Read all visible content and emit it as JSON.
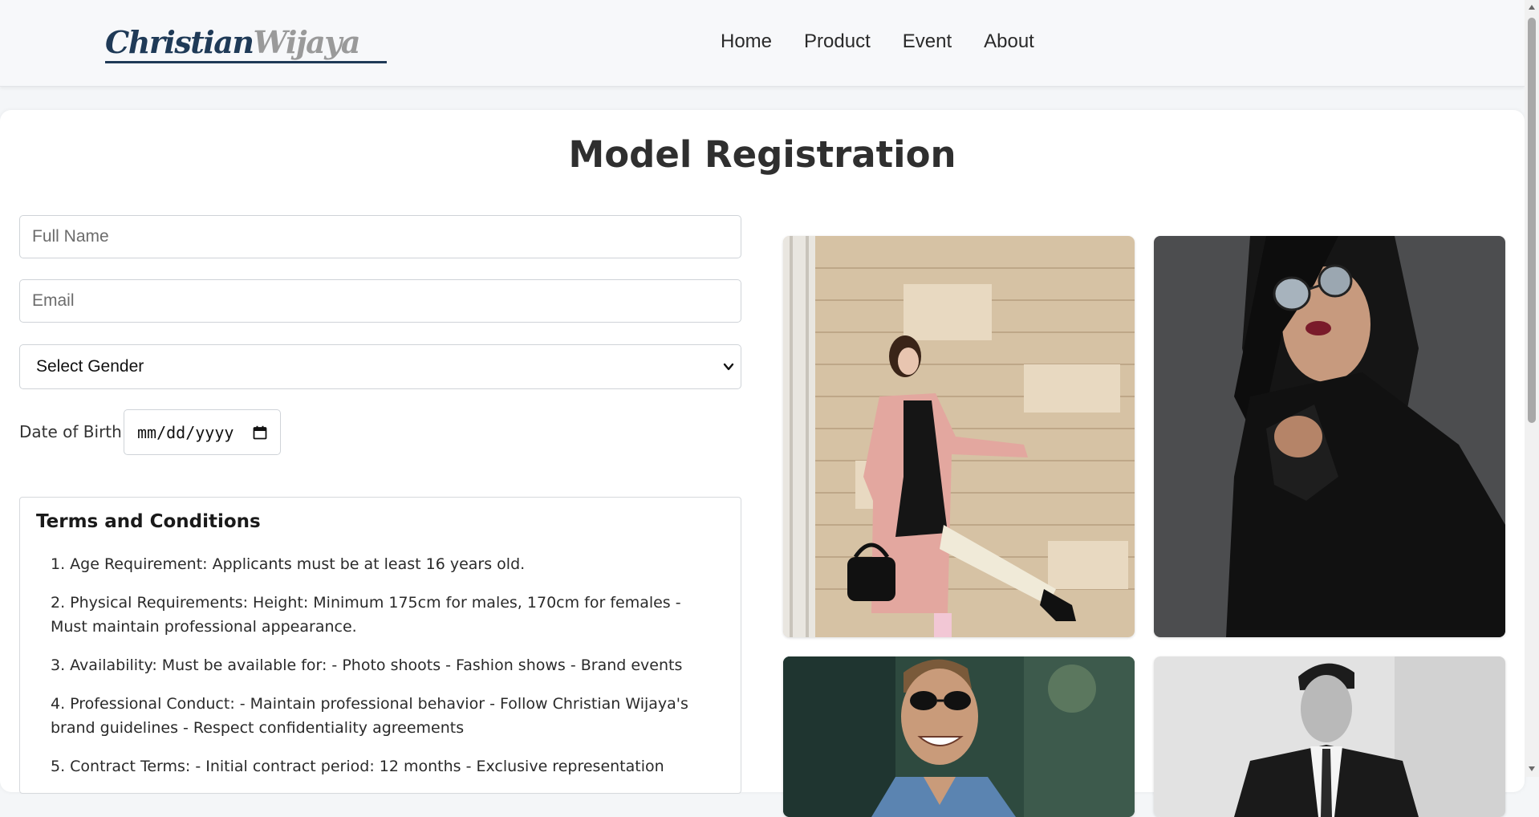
{
  "brand": {
    "first": "Christian",
    "last": "Wijaya"
  },
  "nav": [
    "Home",
    "Product",
    "Event",
    "About"
  ],
  "page_title": "Model Registration",
  "form": {
    "full_name_placeholder": "Full Name",
    "email_placeholder": "Email",
    "gender_selected": "Select Gender",
    "dob_label": "Date of Birth",
    "dob_placeholder": "mm/dd/yyyy"
  },
  "terms": {
    "title": "Terms and Conditions",
    "items": [
      "1. Age Requirement: Applicants must be at least 16 years old.",
      "2. Physical Requirements: Height: Minimum 175cm for males, 170cm for females - Must maintain professional appearance.",
      "3. Availability: Must be available for: - Photo shoots - Fashion shows - Brand events",
      "4. Professional Conduct: - Maintain professional behavior - Follow Christian Wijaya's brand guidelines - Respect confidentiality agreements",
      "5. Contract Terms: - Initial contract period: 12 months - Exclusive representation"
    ]
  },
  "colors": {
    "brand_dark": "#1f3a57",
    "brand_gray": "#9a9a9a",
    "page_bg": "#f4f6f8"
  }
}
